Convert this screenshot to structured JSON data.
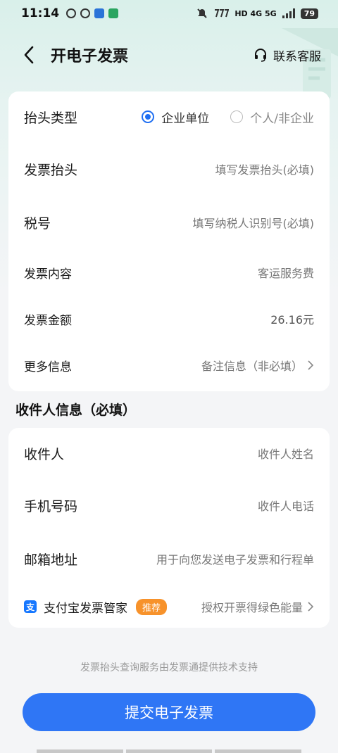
{
  "status_bar": {
    "time": "11:14",
    "right_text": "HD 4G 5G",
    "battery": "79"
  },
  "header": {
    "title": "开电子发票",
    "service_label": "联系客服"
  },
  "invoice_form": {
    "title_type": {
      "label": "抬头类型",
      "options": [
        {
          "label": "企业单位",
          "selected": true
        },
        {
          "label": "个人/非企业",
          "selected": false
        }
      ]
    },
    "invoice_title": {
      "label": "发票抬头",
      "placeholder": "填写发票抬头(必填)"
    },
    "tax_id": {
      "label": "税号",
      "placeholder": "填写纳税人识别号(必填)"
    },
    "content": {
      "label": "发票内容",
      "value": "客运服务费"
    },
    "amount": {
      "label": "发票金额",
      "value": "26.16元"
    },
    "more_info": {
      "label": "更多信息",
      "value": "备注信息（非必填）"
    }
  },
  "recipient_section": {
    "title": "收件人信息（必填）",
    "name": {
      "label": "收件人",
      "placeholder": "收件人姓名"
    },
    "phone": {
      "label": "手机号码",
      "placeholder": "收件人电话"
    },
    "email": {
      "label": "邮箱地址",
      "placeholder": "用于向您发送电子发票和行程单"
    },
    "alipay": {
      "icon_text": "支",
      "label": "支付宝发票管家",
      "badge": "推荐",
      "value": "授权开票得绿色能量"
    }
  },
  "footnote": "发票抬头查询服务由发票通提供技术支持",
  "submit_label": "提交电子发票",
  "colors": {
    "accent": "#2f76f5",
    "badge": "#f7922b",
    "alipay": "#1677ff"
  }
}
